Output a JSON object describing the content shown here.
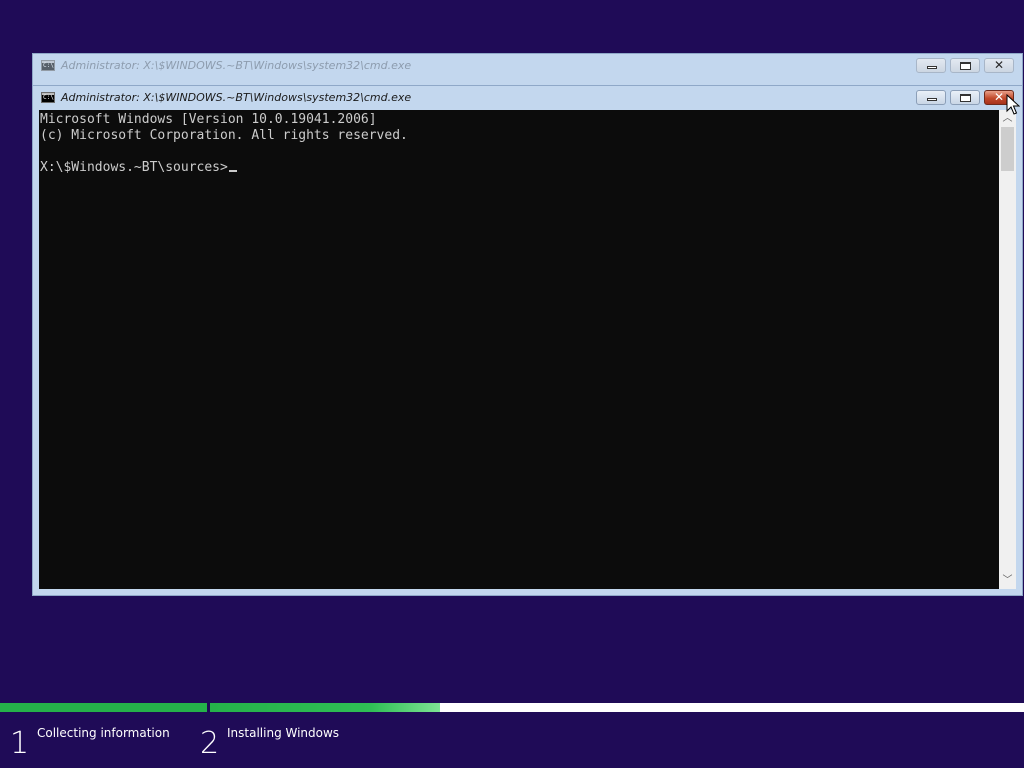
{
  "windows": {
    "back": {
      "title": "Administrator: X:\\$WINDOWS.~BT\\Windows\\system32\\cmd.exe"
    },
    "front": {
      "title": "Administrator: X:\\$WINDOWS.~BT\\Windows\\system32\\cmd.exe",
      "console_lines": [
        "Microsoft Windows [Version 10.0.19041.2006]",
        "(c) Microsoft Corporation. All rights reserved.",
        "",
        "X:\\$Windows.~BT\\sources>"
      ]
    }
  },
  "setup": {
    "steps": [
      {
        "number": "1",
        "label": "Collecting information",
        "progress": 1.0
      },
      {
        "number": "2",
        "label": "Installing Windows",
        "progress": 0.283
      }
    ]
  },
  "icons": {
    "cmd": "cmd-icon",
    "minimize": "minimize-icon",
    "maximize": "maximize-icon",
    "close": "close-icon",
    "scroll_up": "chevron-up-icon",
    "scroll_down": "chevron-down-icon",
    "pointer": "mouse-pointer-icon"
  },
  "colors": {
    "desktop_bg": "#1f0b57",
    "console_bg": "#0c0c0c",
    "console_fg": "#cccccc",
    "progress_green": "#25b24a",
    "close_hover": "#c24a2c"
  }
}
